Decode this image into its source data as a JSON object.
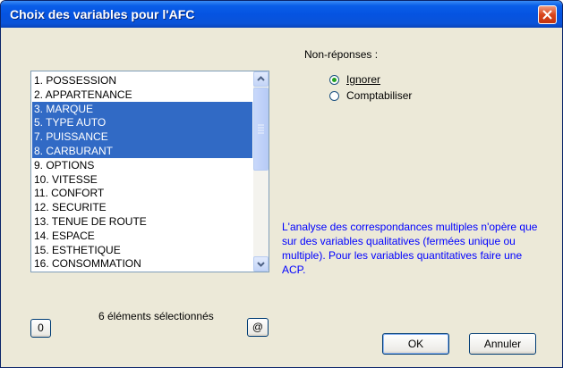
{
  "window": {
    "title": "Choix des variables pour l'AFC"
  },
  "variables": {
    "items": [
      {
        "label": "1. POSSESSION",
        "selected": false
      },
      {
        "label": "2. APPARTENANCE",
        "selected": false
      },
      {
        "label": "3. MARQUE",
        "selected": true
      },
      {
        "label": "5. TYPE AUTO",
        "selected": true
      },
      {
        "label": "7. PUISSANCE",
        "selected": true
      },
      {
        "label": "8. CARBURANT",
        "selected": true
      },
      {
        "label": "9. OPTIONS",
        "selected": false
      },
      {
        "label": "10. VITESSE",
        "selected": false
      },
      {
        "label": "11. CONFORT",
        "selected": false
      },
      {
        "label": "12. SECURITE",
        "selected": false
      },
      {
        "label": "13. TENUE DE ROUTE",
        "selected": false
      },
      {
        "label": "14. ESPACE",
        "selected": false
      },
      {
        "label": "15. ESTHETIQUE",
        "selected": false
      },
      {
        "label": "16. CONSOMMATION",
        "selected": false
      }
    ]
  },
  "nonresponse": {
    "label": "Non-réponses :",
    "options": [
      {
        "label": "Ignorer",
        "checked": true
      },
      {
        "label": "Comptabiliser",
        "checked": false
      }
    ]
  },
  "info": "L'analyse des correspondances multiples n'opère que sur des variables qualitatives (fermées unique ou multiple). Pour les variables quantitatives faire une ACP.",
  "selection": {
    "count_text": "6 éléments sélectionnés",
    "clear_label": "0",
    "all_label": "@"
  },
  "buttons": {
    "ok": "OK",
    "cancel": "Annuler"
  },
  "colors": {
    "title_bar": "#0553e1",
    "selection": "#316ac5",
    "info_text": "#0000ff",
    "dialog_bg": "#ece9d8"
  }
}
